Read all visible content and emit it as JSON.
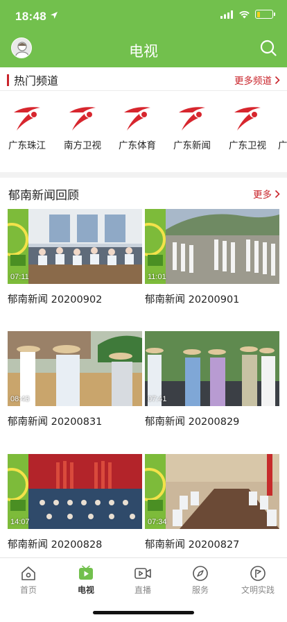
{
  "status": {
    "time": "18:48",
    "battery_level": 0.22
  },
  "header": {
    "title": "电视",
    "accent": "#72c04d"
  },
  "hot_channels": {
    "title": "热门频道",
    "more_label": "更多频道",
    "items": [
      {
        "name": "广东珠江"
      },
      {
        "name": "南方卫视"
      },
      {
        "name": "广东体育"
      },
      {
        "name": "广东新闻"
      },
      {
        "name": "广东卫视"
      },
      {
        "name": "广"
      }
    ]
  },
  "news_review": {
    "title": "郁南新闻回顾",
    "more_label": "更多",
    "items": [
      {
        "title": "郁南新闻 20200902",
        "duration": "07:11"
      },
      {
        "title": "郁南新闻 20200901",
        "duration": "11:01"
      },
      {
        "title": "郁南新闻 20200831",
        "duration": "08:43"
      },
      {
        "title": "郁南新闻 20200829",
        "duration": "07:41"
      },
      {
        "title": "郁南新闻 20200828",
        "duration": "14:07"
      },
      {
        "title": "郁南新闻 20200827",
        "duration": "07:34"
      }
    ]
  },
  "tabbar": {
    "items": [
      {
        "label": "首页",
        "icon": "home-icon"
      },
      {
        "label": "电视",
        "icon": "tv-icon",
        "active": true
      },
      {
        "label": "直播",
        "icon": "video-camera-icon"
      },
      {
        "label": "服务",
        "icon": "compass-icon"
      },
      {
        "label": "文明实践",
        "icon": "flag-badge-icon"
      }
    ]
  },
  "colors": {
    "brand_green": "#72c04d",
    "accent_red": "#c9242b",
    "logo_red": "#d7262e"
  }
}
